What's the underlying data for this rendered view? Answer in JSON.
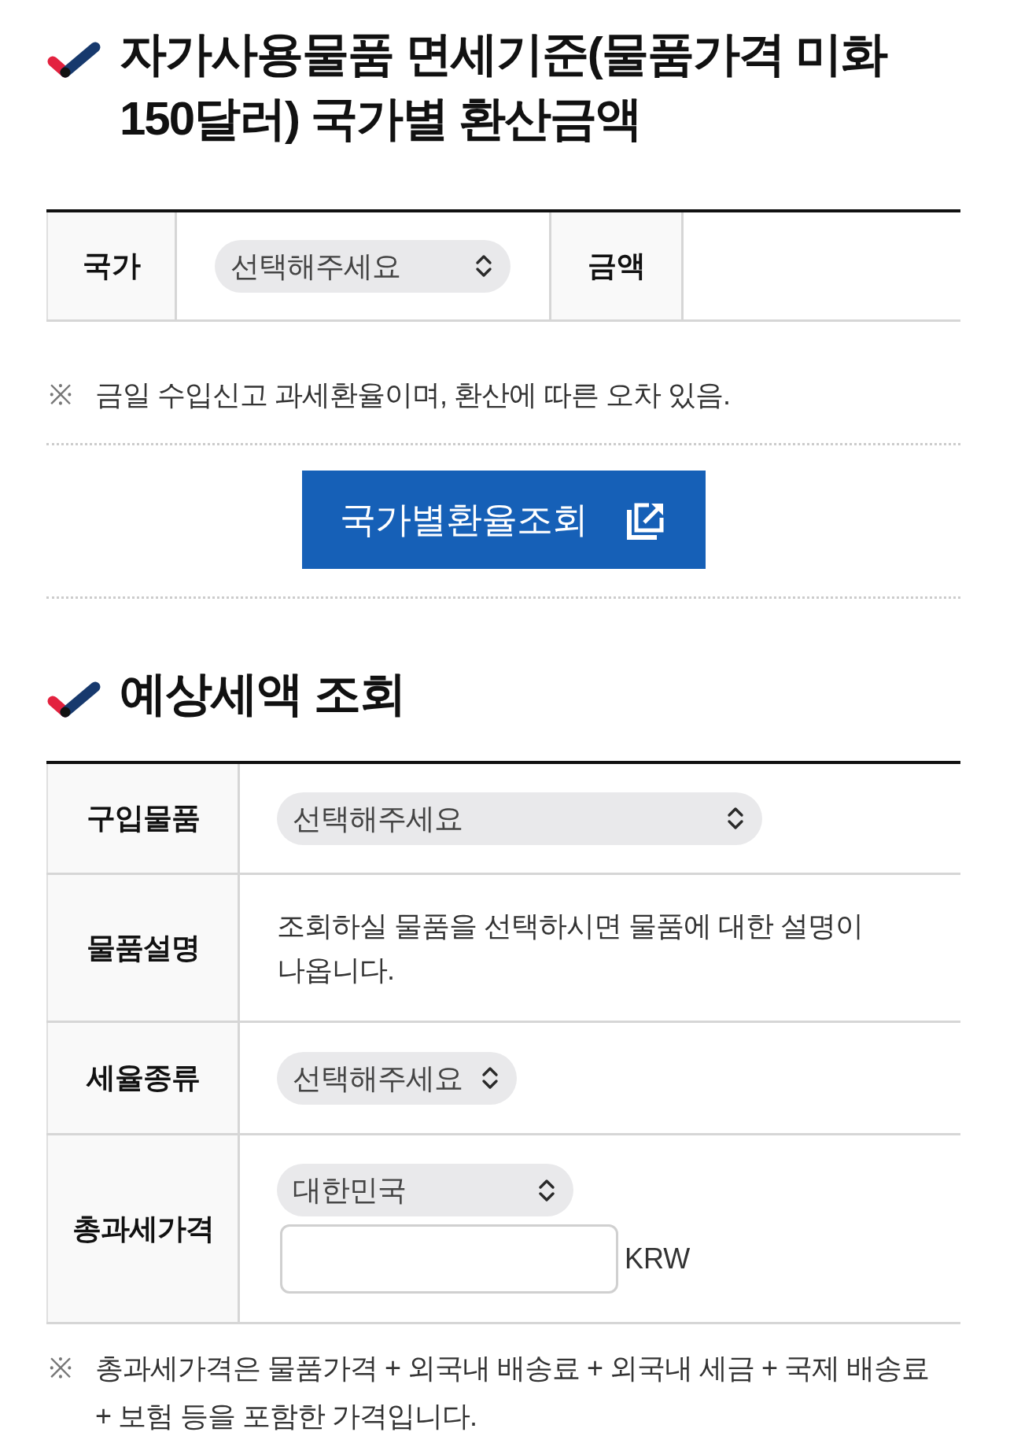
{
  "exchange": {
    "title": "자가사용물품 면세기준(물품가격 미화 150달러) 국가별 환산금액",
    "country_label": "국가",
    "country_select": "선택해주세요",
    "amount_label": "금액",
    "note": {
      "mark": "※",
      "text": "금일 수입신고 과세환율이며, 환산에 따른 오차 있음."
    },
    "button": "국가별환율조회"
  },
  "tax": {
    "title": "예상세액 조회",
    "rows": [
      {
        "kind": "select",
        "label": "구입물품",
        "value": "선택해주세요"
      },
      {
        "kind": "text",
        "label": "물품설명",
        "text": "조회하실 물품을 선택하시면 물품에 대한 설명이 나옵니다."
      },
      {
        "kind": "select",
        "label": "세율종류",
        "value": "선택해주세요"
      },
      {
        "kind": "price",
        "label": "총과세가격",
        "value": "대한민국",
        "unit": "KRW"
      }
    ],
    "note": {
      "mark": "※",
      "text": "총과세가격은 물품가격 + 외국내 배송료 + 외국내 세금 + 국제 배송료 + 보험 등을 포함한 가격입니다."
    }
  }
}
